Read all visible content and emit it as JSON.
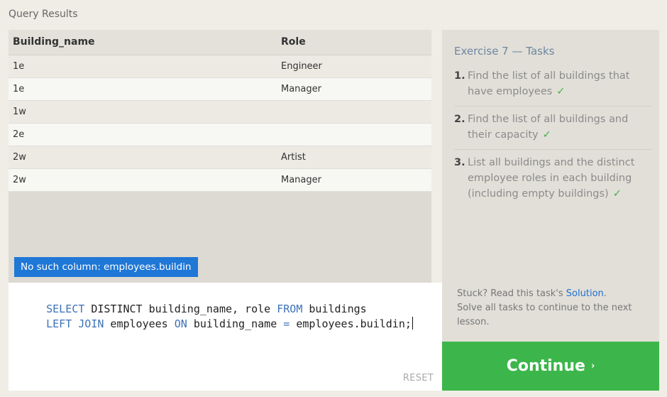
{
  "results": {
    "title": "Query Results",
    "columns": [
      "Building_name",
      "Role"
    ],
    "rows": [
      [
        "1e",
        "Engineer"
      ],
      [
        "1e",
        "Manager"
      ],
      [
        "1w",
        ""
      ],
      [
        "2e",
        ""
      ],
      [
        "2w",
        "Artist"
      ],
      [
        "2w",
        "Manager"
      ]
    ]
  },
  "error": {
    "message": "No such column: employees.buildin"
  },
  "editor": {
    "line1": [
      {
        "text": "SELECT",
        "kw": true
      },
      {
        "text": " DISTINCT building_name, role ",
        "kw": false
      },
      {
        "text": "FROM",
        "kw": true
      },
      {
        "text": " buildings",
        "kw": false
      }
    ],
    "line2": [
      {
        "text": "LEFT JOIN",
        "kw": true
      },
      {
        "text": " employees ",
        "kw": false
      },
      {
        "text": "ON",
        "kw": true
      },
      {
        "text": " building_name ",
        "kw": false
      },
      {
        "text": "=",
        "kw": true
      },
      {
        "text": " employees.buildin;",
        "kw": false
      }
    ],
    "reset_label": "RESET"
  },
  "tasks": {
    "title": "Exercise 7 — Tasks",
    "items": [
      {
        "num": "1.",
        "text": "Find the list of all buildings that have employees",
        "done": "✓"
      },
      {
        "num": "2.",
        "text": "Find the list of all buildings and their capacity",
        "done": "✓"
      },
      {
        "num": "3.",
        "text": "List all buildings and the distinct employee roles in each building (including empty buildings)",
        "done": "✓"
      }
    ]
  },
  "hint": {
    "prefix": "Stuck? Read this task's ",
    "link": "Solution",
    "suffix": ".",
    "line2": "Solve all tasks to continue to the next lesson."
  },
  "continue": {
    "label": "Continue",
    "chevron": "›"
  },
  "colors": {
    "keyword": "#3c72b8",
    "accent": "#3cb64a",
    "error_bg": "#1f77d6",
    "link": "#1f6fd1"
  }
}
